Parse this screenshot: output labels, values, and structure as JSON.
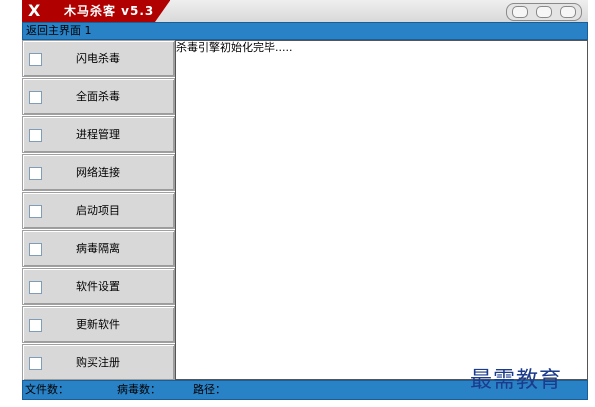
{
  "window": {
    "title": "木马杀客 v5.3",
    "close_glyph": "X"
  },
  "topbar": {
    "text": "返回主界面 1"
  },
  "sidebar": {
    "items": [
      {
        "label": "闪电杀毒"
      },
      {
        "label": "全面杀毒"
      },
      {
        "label": "进程管理"
      },
      {
        "label": "网络连接"
      },
      {
        "label": "启动项目"
      },
      {
        "label": "病毒隔离"
      },
      {
        "label": "软件设置"
      },
      {
        "label": "更新软件"
      },
      {
        "label": "购买注册"
      }
    ]
  },
  "log": {
    "message": "杀毒引擎初始化完毕....."
  },
  "status": {
    "files_label": "文件数：",
    "virus_label": "病毒数：",
    "path_label": "路径："
  },
  "watermark": {
    "text": "最需教育"
  },
  "colors": {
    "title_red": "#b00000",
    "bar_blue": "#2a82c6",
    "button_gray": "#d8d8d8"
  }
}
